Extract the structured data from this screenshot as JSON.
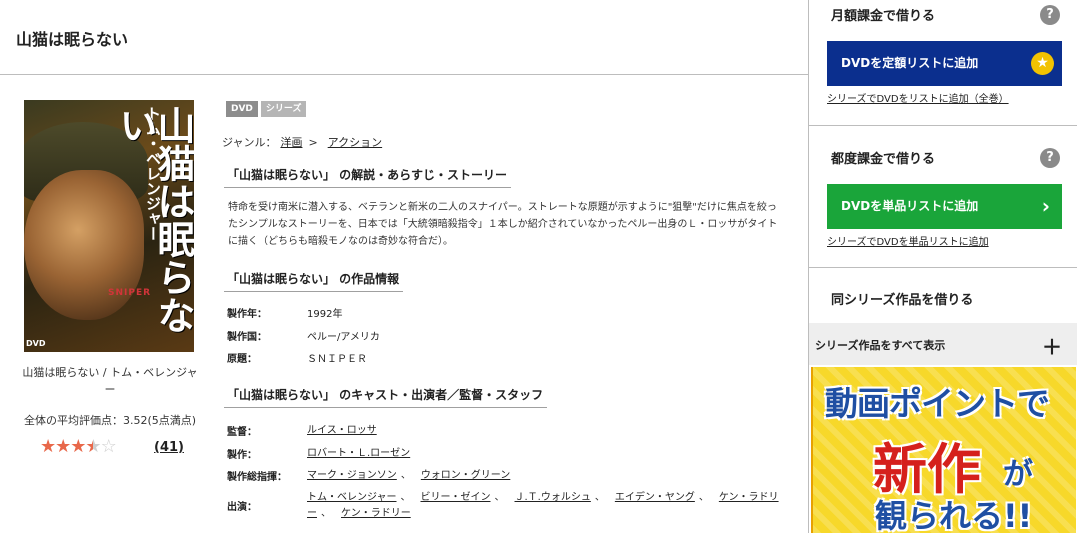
{
  "page": {
    "title": "山猫は眠らない"
  },
  "cover": {
    "title_vertical": "山猫は眠らない",
    "actor_vertical": "トム・ベレンジャー",
    "logo_text": "SNIPER",
    "format_text": "DVD",
    "caption": "山猫は眠らない / トム・ベレンジャー"
  },
  "rating": {
    "average_text": "全体の平均評価点：3.52(5点満点)",
    "value": 3.52,
    "max": 5,
    "count_text": "(41)"
  },
  "badges": [
    "DVD",
    "シリーズ"
  ],
  "genre": {
    "label": "ジャンル：",
    "items": [
      "洋画",
      "アクション"
    ],
    "separator": ">"
  },
  "sections": {
    "story_heading": "「山猫は眠らない」 の解説・あらすじ・ストーリー",
    "story_text": "特命を受け南米に潜入する、ベテランと新米の二人のスナイパー。ストレートな原題が示すように\"狙撃\"だけに焦点を絞ったシンプルなストーリーを、日本では「大統領暗殺指令」１本しか紹介されていなかったペルー出身のＬ・ロッサがタイトに描く（どちらも暗殺モノなのは奇妙な符合だ）。",
    "info_heading": "「山猫は眠らない」 の作品情報",
    "info": [
      {
        "label": "製作年：",
        "value": "1992年"
      },
      {
        "label": "製作国：",
        "value": "ペルー/アメリカ"
      },
      {
        "label": "原題：",
        "value": "ＳＮＩＰＥＲ"
      }
    ],
    "staff_heading": "「山猫は眠らない」 のキャスト・出演者／監督・スタッフ",
    "staff": {
      "director_label": "監督：",
      "director": [
        "ルイス・ロッサ"
      ],
      "producer_label": "製作：",
      "producer": [
        "ロバート・Ｌ.ローゼン"
      ],
      "executive_label": "製作総指揮：",
      "executive": [
        "マーク・ジョンソン",
        "ウォロン・グリーン"
      ],
      "cast_label": "出演：",
      "cast_line1": [
        "トム・ベレンジャー",
        "ビリー・ゼイン",
        "Ｊ.Ｔ.ウォルシュ",
        "エイデン・ヤング",
        "ケン・ラドリ"
      ],
      "cast_line2a": "ー",
      "cast_line2b": "ケン・ラドリー"
    }
  },
  "sidebar": {
    "monthly": {
      "heading": "月額課金で借りる",
      "button": "DVDを定額リストに追加",
      "link": "シリーズでDVDをリストに追加（全巻）"
    },
    "single": {
      "heading": "都度課金で借りる",
      "button": "DVDを単品リストに追加",
      "link": "シリーズでDVDを単品リストに追加"
    },
    "series_heading": "同シリーズ作品を借りる",
    "series_all": "シリーズ作品をすべて表示",
    "help_symbol": "?",
    "plus_symbol": "＋",
    "banner": {
      "line1": "動画ポイントで",
      "line2": "新作",
      "line3": "が",
      "line4": "観られる!!"
    },
    "colors": {
      "blue_button": "#0b2f8e",
      "green_button": "#1aa53a",
      "star_badge": "#f2c200"
    }
  }
}
